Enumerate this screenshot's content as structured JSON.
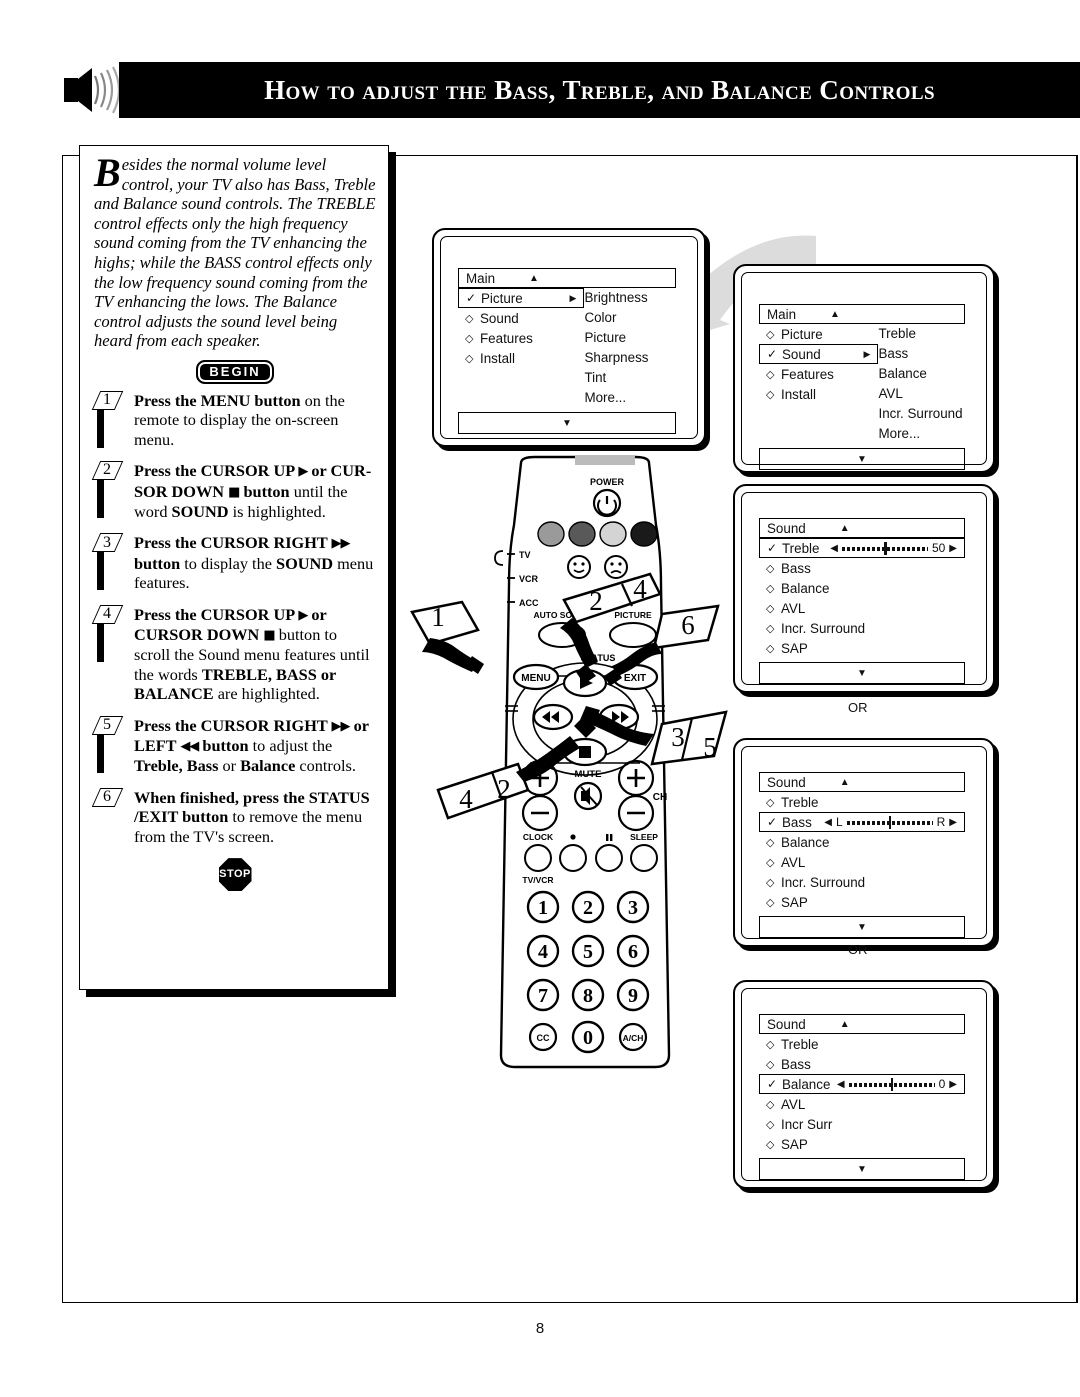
{
  "header": {
    "icon": "speaker-sound-icon",
    "title": "How to adjust the Bass, Treble, and Balance Controls"
  },
  "page_number": "8",
  "instructions": {
    "intro_dropcap": "B",
    "intro": "esides the normal volume level control, your TV also has Bass, Treble and Balance sound controls. The TREBLE control effects only the high frequency sound coming from the TV enhancing the highs; while the BASS control effects only the low frequency sound coming from the TV enhancing the lows. The Balance control adjusts the sound level being heard from each speaker.",
    "begin_label": "BEGIN",
    "stop_label": "STOP",
    "steps": [
      {
        "num": "1",
        "html": "<b>Press the MENU button</b> on the remote to display the on-screen menu."
      },
      {
        "num": "2",
        "html": "<b>Press the CURSOR UP <span class='gl'>▶</span> or CUR-SOR DOWN <span class='gl'>■</span> button</b> until the word <b>SOUND</b> is highlighted."
      },
      {
        "num": "3",
        "html": "<b>Press the CURSOR RIGHT <span class='gl'>▶▶</span> button</b> to display the <b>SOUND</b> menu features."
      },
      {
        "num": "4",
        "html": "<b>Press the CURSOR UP <span class='gl'>▶</span> or CURSOR DOWN <span class='gl'>■</span></b> button to scroll the Sound menu features until the words <b>TREBLE, BASS or BALANCE</b> are highlighted."
      },
      {
        "num": "5",
        "html": "<b>Press the CURSOR RIGHT <span class='gl'>▶▶</span> or LEFT <span class='gl'>◀◀</span> button</b> to adjust the <b>Treble, Bass</b> or <b>Balance</b> controls."
      },
      {
        "num": "6",
        "html": "<b>When finished, press the STATUS /EXIT button</b> to remove the menu from the TV's screen."
      }
    ]
  },
  "screens": [
    {
      "name": "main-picture",
      "title": "Main",
      "title_arrow": "▲",
      "bottom_arrow": "▼",
      "items": [
        {
          "label": "Picture",
          "selected": true,
          "caret": "▶"
        },
        {
          "label": "Sound",
          "selected": false
        },
        {
          "label": "Features",
          "selected": false
        },
        {
          "label": "Install",
          "selected": false
        }
      ],
      "submenu": [
        "Brightness",
        "Color",
        "Picture",
        "Sharpness",
        "Tint",
        "More..."
      ]
    },
    {
      "name": "main-sound",
      "title": "Main",
      "title_arrow": "▲",
      "bottom_arrow": "▼",
      "items": [
        {
          "label": "Picture",
          "selected": false
        },
        {
          "label": "Sound",
          "selected": true,
          "caret": "▶"
        },
        {
          "label": "Features",
          "selected": false
        },
        {
          "label": "Install",
          "selected": false
        }
      ],
      "submenu": [
        "Treble",
        "Bass",
        "Balance",
        "AVL",
        "Incr. Surround",
        "More..."
      ]
    },
    {
      "name": "sound-treble",
      "title": "Sound",
      "title_arrow": "▲",
      "bottom_arrow": "▼",
      "items": [
        {
          "label": "Treble",
          "selected": true,
          "slider": {
            "value": "50",
            "left_arrow": "◀",
            "right_arrow": "▶",
            "knob_pct": 50
          }
        },
        {
          "label": "Bass",
          "selected": false
        },
        {
          "label": "Balance",
          "selected": false
        },
        {
          "label": "AVL",
          "selected": false
        },
        {
          "label": "Incr. Surround",
          "selected": false
        },
        {
          "label": "SAP",
          "selected": false
        }
      ]
    },
    {
      "name": "sound-bass",
      "title": "Sound",
      "title_arrow": "▲",
      "bottom_arrow": "▼",
      "items": [
        {
          "label": "Treble",
          "selected": false
        },
        {
          "label": "Bass",
          "selected": true,
          "slider": {
            "value": "",
            "prefix": "L",
            "suffix": "R",
            "left_arrow": "◀",
            "right_arrow": "▶",
            "knob_pct": 50
          }
        },
        {
          "label": "Balance",
          "selected": false
        },
        {
          "label": "AVL",
          "selected": false
        },
        {
          "label": "Incr. Surround",
          "selected": false
        },
        {
          "label": "SAP",
          "selected": false
        }
      ]
    },
    {
      "name": "sound-balance",
      "title": "Sound",
      "title_arrow": "▲",
      "bottom_arrow": "▼",
      "items": [
        {
          "label": "Treble",
          "selected": false
        },
        {
          "label": "Bass",
          "selected": false
        },
        {
          "label": "Balance",
          "selected": true,
          "slider": {
            "value": "0",
            "left_arrow": "◀",
            "right_arrow": "▶",
            "knob_pct": 50
          }
        },
        {
          "label": "AVL",
          "selected": false
        },
        {
          "label": "Incr Surr",
          "selected": false
        },
        {
          "label": "SAP",
          "selected": false
        }
      ]
    }
  ],
  "or_labels": [
    "OR",
    "OR"
  ],
  "remote": {
    "power_label": "POWER",
    "source_labels": [
      "TV",
      "VCR",
      "ACC"
    ],
    "auto_sound_label": "AUTO SOUND",
    "picture_label": "PICTURE",
    "status_label": "STATUS",
    "menu_label": "MENU",
    "exit_label": "EXIT",
    "mute_label": "MUTE",
    "ch_label": "CH",
    "clock_label": "CLOCK",
    "sleep_label": "SLEEP",
    "tvvcr_label": "TV/VCR",
    "keypad": [
      "1",
      "2",
      "3",
      "4",
      "5",
      "6",
      "7",
      "8",
      "9",
      "CC",
      "0",
      "A/CH"
    ],
    "callouts": [
      {
        "id": "callout-1",
        "label": "1",
        "target": "menu-button"
      },
      {
        "id": "callout-2-top",
        "label": "2",
        "target": "cursor-up-button"
      },
      {
        "id": "callout-4-top",
        "label": "4",
        "target": "cursor-up-button"
      },
      {
        "id": "callout-6",
        "label": "6",
        "target": "exit-button"
      },
      {
        "id": "callout-3",
        "label": "3",
        "target": "cursor-right-button"
      },
      {
        "id": "callout-5",
        "label": "5",
        "target": "cursor-right-button"
      },
      {
        "id": "callout-2-bottom",
        "label": "2",
        "target": "cursor-down-button"
      },
      {
        "id": "callout-4-bottom",
        "label": "4",
        "target": "cursor-down-button"
      }
    ]
  }
}
